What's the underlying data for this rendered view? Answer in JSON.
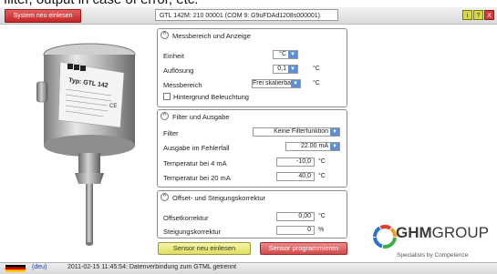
{
  "top_caption": "filter, output in case of error, etc.",
  "toolbar": {
    "read_system_label": "System neu einlesen",
    "device_title": "GTL 142M: 210 00001 (COM 9: G9uFDAd1208s000001)",
    "info_label": "i",
    "help_label": "?",
    "close_label": "X"
  },
  "sensor": {
    "brand": "GHM",
    "type_label": "Typ: GTL 142",
    "icon": "sensor-device-image"
  },
  "panel_measure": {
    "title": "Messbereich und Anzeige",
    "collapse_icon": "^",
    "unit_label": "Einheit",
    "unit_value": "°C",
    "resolution_label": "Auflösung",
    "resolution_value": "0,1",
    "resolution_unit": "°C",
    "range_label": "Messbereich",
    "range_value": "Frei skalierbar",
    "range_unit": "°C",
    "backlight_label": "Hintergrund Beleuchtung"
  },
  "panel_filter": {
    "title": "Filter und Ausgabe",
    "collapse_icon": "^",
    "filter_label": "Filter",
    "filter_value": "Keine Filterfunktion",
    "error_output_label": "Ausgabe im Fehlerfall",
    "error_output_value": "22.00 mA",
    "temp_4ma_label": "Temperatur bei 4 mA",
    "temp_4ma_value": "-10,0",
    "temp_4ma_unit": "°C",
    "temp_20ma_label": "Temperatur bei 20 mA",
    "temp_20ma_value": "40,0",
    "temp_20ma_unit": "°C"
  },
  "panel_offset": {
    "title": "Offset- und Steigungskorrektur",
    "collapse_icon": "^",
    "offset_label": "Offsetkorrektur",
    "offset_value": "0,00",
    "offset_unit": "°C",
    "slope_label": "Steigungskorrektur",
    "slope_value": "0",
    "slope_unit": "%"
  },
  "actions": {
    "read_sensor_label": "Sensor neu einlesen",
    "program_sensor_label": "Sensor programmieren"
  },
  "logo": {
    "brand": "GHM",
    "group": "GROUP",
    "tagline": "Specialists by Competence."
  },
  "statusbar": {
    "language": "(deu)",
    "message": "2011-02-15 11:45:54: Datenverbindung zum GTML getrennt"
  },
  "colors": {
    "toolbar_red": "#c42626",
    "accent_blue": "#5d8fd4",
    "button_yellow": "#dede60",
    "button_red": "#d24a4a"
  }
}
